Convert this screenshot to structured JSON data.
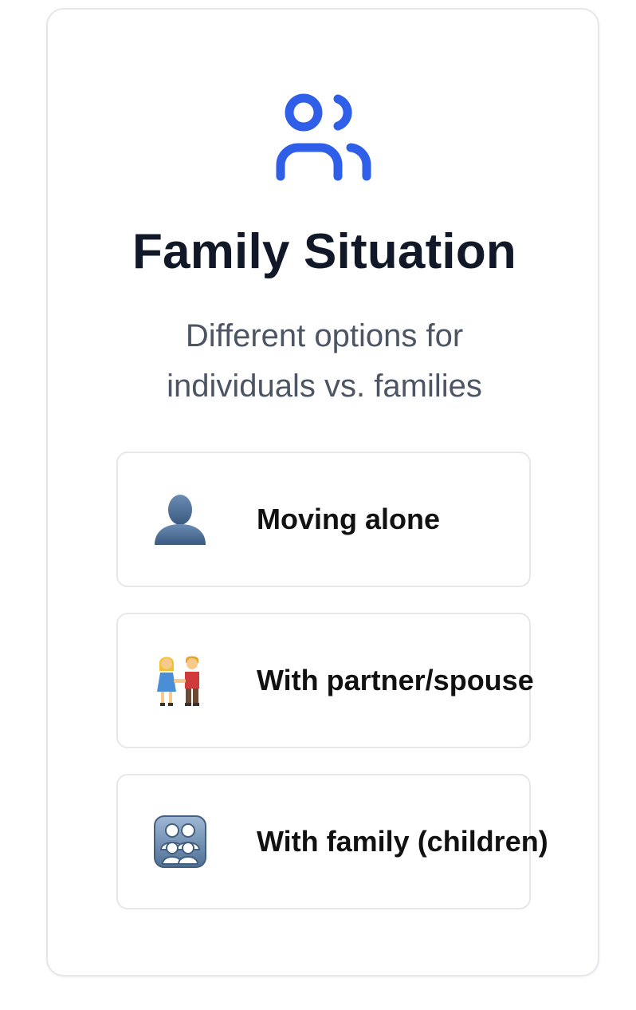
{
  "header": {
    "icon": "users-icon",
    "title": "Family Situation",
    "subtitle": "Different options for individuals vs. families"
  },
  "options": [
    {
      "icon": "person-silhouette-icon",
      "label": "Moving alone"
    },
    {
      "icon": "couple-icon",
      "label": "With partner/spouse"
    },
    {
      "icon": "family-icon",
      "label": "With family (children)"
    }
  ],
  "colors": {
    "accent": "#2f5fe8",
    "title": "#111827",
    "subtitle": "#4b5563",
    "border": "#e5e7eb"
  }
}
